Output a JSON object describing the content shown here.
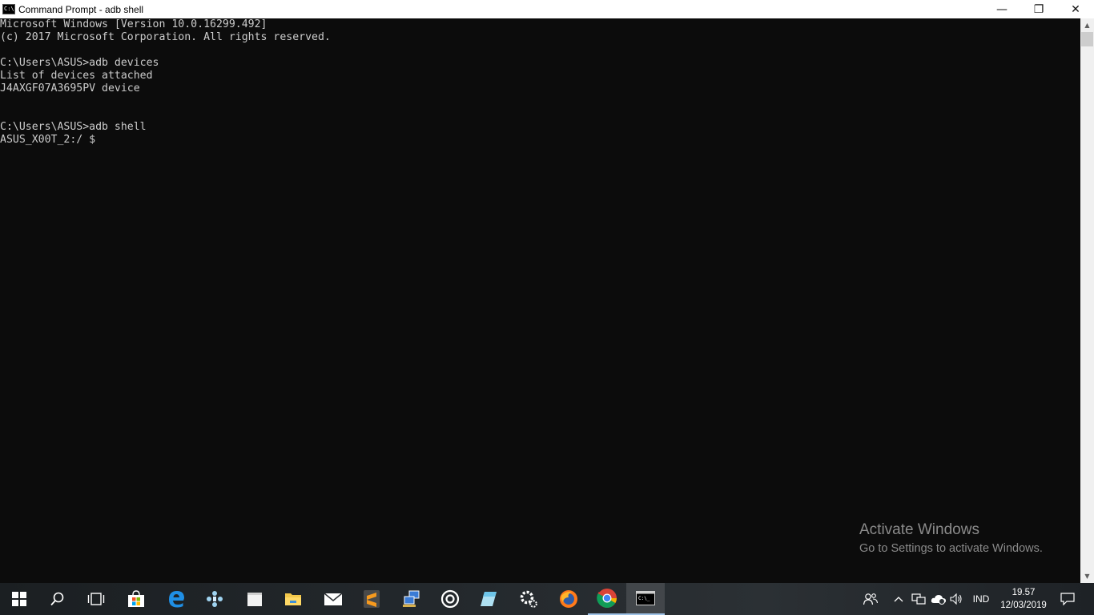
{
  "window": {
    "title": "Command Prompt - adb  shell",
    "icon": "cmd-icon",
    "minimize_glyph": "—",
    "maximize_glyph": "❐",
    "close_glyph": "✕"
  },
  "console": {
    "lines": [
      "Microsoft Windows [Version 10.0.16299.492]",
      "(c) 2017 Microsoft Corporation. All rights reserved.",
      "",
      "C:\\Users\\ASUS>adb devices",
      "List of devices attached",
      "J4AXGF07A3695PV device",
      "",
      "",
      "C:\\Users\\ASUS>adb shell",
      "ASUS_X00T_2:/ $"
    ]
  },
  "watermark": {
    "line1": "Activate Windows",
    "line2": "Go to Settings to activate Windows."
  },
  "taskbar": {
    "apps": [
      {
        "name": "start-icon"
      },
      {
        "name": "search-icon"
      },
      {
        "name": "task-view-icon"
      },
      {
        "name": "store-icon"
      },
      {
        "name": "edge-icon"
      },
      {
        "name": "game-controller-icon"
      },
      {
        "name": "file-icon"
      },
      {
        "name": "file-explorer-icon"
      },
      {
        "name": "mail-icon"
      },
      {
        "name": "sublime-text-icon"
      },
      {
        "name": "network-tool-icon"
      },
      {
        "name": "groove-music-icon"
      },
      {
        "name": "notes-icon"
      },
      {
        "name": "settings-icon"
      },
      {
        "name": "firefox-icon"
      },
      {
        "name": "chrome-icon"
      },
      {
        "name": "command-prompt-icon"
      }
    ],
    "tray": {
      "language": "IND",
      "time": "19.57",
      "date": "12/03/2019"
    }
  },
  "colors": {
    "console_bg": "#0c0c0c",
    "console_fg": "#cccccc",
    "accent": "#9ec2e6"
  }
}
